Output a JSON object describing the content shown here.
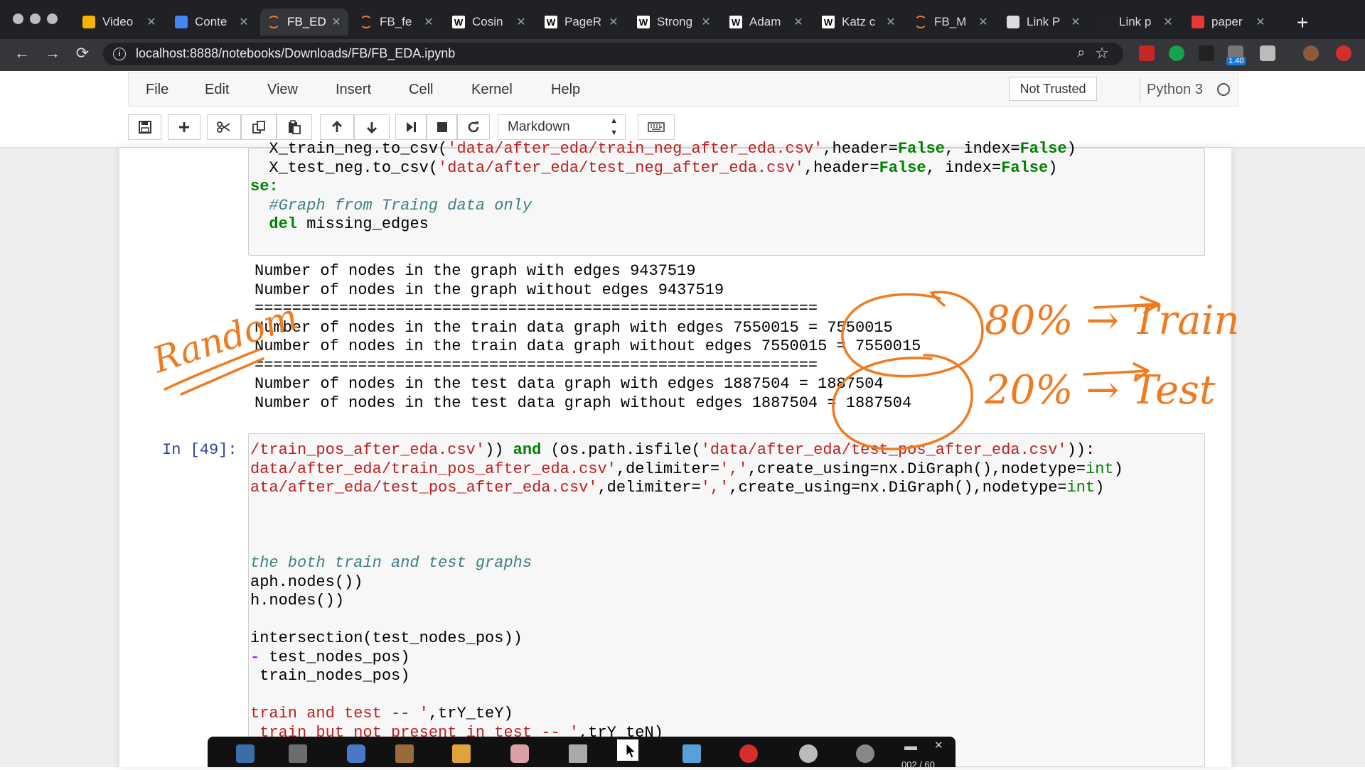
{
  "browser": {
    "tabs": [
      {
        "title": "Video",
        "icon": "google-drive-icon",
        "active": false
      },
      {
        "title": "Conte",
        "icon": "google-docs-icon",
        "active": false
      },
      {
        "title": "FB_ED",
        "icon": "jupyter-icon",
        "active": true
      },
      {
        "title": "FB_fe",
        "icon": "jupyter-icon",
        "active": false
      },
      {
        "title": "Cosin",
        "icon": "wikipedia-icon",
        "active": false
      },
      {
        "title": "PageR",
        "icon": "wikipedia-icon",
        "active": false
      },
      {
        "title": "Strong",
        "icon": "wikipedia-icon",
        "active": false
      },
      {
        "title": "Adam",
        "icon": "wikipedia-icon",
        "active": false
      },
      {
        "title": "Katz c",
        "icon": "wikipedia-icon",
        "active": false
      },
      {
        "title": "FB_M",
        "icon": "jupyter-icon",
        "active": false
      },
      {
        "title": "Link P",
        "icon": "document-icon",
        "active": false
      },
      {
        "title": "Link p",
        "icon": "github-icon",
        "active": false
      },
      {
        "title": "paper",
        "icon": "pdf-icon",
        "active": false
      }
    ],
    "new_tab_label": "+",
    "url": "localhost:8888/notebooks/Downloads/FB/FB_EDA.ipynb",
    "extension_badge": "1.40",
    "icons": {
      "back": "←",
      "forward": "→",
      "reload": "⟳",
      "zoom": "⌕",
      "star": "☆"
    }
  },
  "jupyter": {
    "menus": [
      "File",
      "Edit",
      "View",
      "Insert",
      "Cell",
      "Kernel",
      "Help"
    ],
    "trust_status": "Not Trusted",
    "kernel_name": "Python 3",
    "toolbar_icons": [
      "save-icon",
      "add-cell-icon",
      "cut-icon",
      "copy-icon",
      "paste-icon",
      "move-up-icon",
      "move-down-icon",
      "run-icon",
      "stop-icon",
      "restart-icon",
      "keyboard-icon"
    ],
    "cell_type": "Markdown"
  },
  "cells": {
    "cell1": {
      "code_lines": [
        [
          {
            "t": "  X_train_neg.to_csv("
          },
          {
            "t": "'data/after_eda/train_neg_after_eda.csv'",
            "c": "str"
          },
          {
            "t": ",header="
          },
          {
            "t": "False",
            "c": "kw"
          },
          {
            "t": ", index="
          },
          {
            "t": "False",
            "c": "kw"
          },
          {
            "t": ")"
          }
        ],
        [
          {
            "t": "  X_test_neg.to_csv("
          },
          {
            "t": "'data/after_eda/test_neg_after_eda.csv'",
            "c": "str"
          },
          {
            "t": ",header="
          },
          {
            "t": "False",
            "c": "kw"
          },
          {
            "t": ", index="
          },
          {
            "t": "False",
            "c": "kw"
          },
          {
            "t": ")"
          }
        ],
        [
          {
            "t": "se:",
            "c": "kw"
          }
        ],
        [
          {
            "t": "  "
          },
          {
            "t": "#Graph from Traing data only",
            "c": "cm"
          }
        ],
        [
          {
            "t": "  "
          },
          {
            "t": "del",
            "c": "kw"
          },
          {
            "t": " missing_edges"
          }
        ]
      ],
      "output_lines": [
        "Number of nodes in the graph with edges 9437519",
        "Number of nodes in the graph without edges 9437519",
        "============================================================",
        "Number of nodes in the train data graph with edges 7550015 = 7550015",
        "Number of nodes in the train data graph without edges 7550015 = 7550015",
        "============================================================",
        "Number of nodes in the test data graph with edges 1887504 = 1887504",
        "Number of nodes in the test data graph without edges 1887504 = 1887504"
      ]
    },
    "cell2": {
      "prompt": "In [49]:",
      "code_lines": [
        [
          {
            "t": "/train_pos_after_eda.csv'",
            "c": "str"
          },
          {
            "t": ")) "
          },
          {
            "t": "and",
            "c": "kw"
          },
          {
            "t": " (os.path.isfile("
          },
          {
            "t": "'data/after_eda/test_pos_after_eda.csv'",
            "c": "str"
          },
          {
            "t": ")):"
          }
        ],
        [
          {
            "t": "data/after_eda/train_pos_after_eda.csv'",
            "c": "str"
          },
          {
            "t": ",delimiter="
          },
          {
            "t": "','",
            "c": "str"
          },
          {
            "t": ",create_using=nx.DiGraph(),nodetype="
          },
          {
            "t": "int",
            "c": "bi"
          },
          {
            "t": ")"
          }
        ],
        [
          {
            "t": "ata/after_eda/test_pos_after_eda.csv'",
            "c": "str"
          },
          {
            "t": ",delimiter="
          },
          {
            "t": "','",
            "c": "str"
          },
          {
            "t": ",create_using=nx.DiGraph(),nodetype="
          },
          {
            "t": "int",
            "c": "bi"
          },
          {
            "t": ")"
          }
        ],
        [
          {
            "t": ""
          }
        ],
        [
          {
            "t": ""
          }
        ],
        [
          {
            "t": ""
          }
        ],
        [
          {
            "t": "the both train and test graphs",
            "c": "cm"
          }
        ],
        [
          {
            "t": "aph.nodes())"
          }
        ],
        [
          {
            "t": "h.nodes())"
          }
        ],
        [
          {
            "t": ""
          }
        ],
        [
          {
            "t": "intersection(test_nodes_pos))"
          }
        ],
        [
          {
            "t": "-",
            "c": "op"
          },
          {
            "t": " test_nodes_pos)"
          }
        ],
        [
          {
            "t": " train_nodes_pos)"
          }
        ],
        [
          {
            "t": ""
          }
        ],
        [
          {
            "t": "train and test -- '",
            "c": "str"
          },
          {
            "t": ",trY_teY)"
          }
        ],
        [
          {
            "t": " train but not present in test -- '",
            "c": "str"
          },
          {
            "t": ",trY_teN)"
          }
        ]
      ]
    }
  },
  "handwritten_annotations": {
    "left": "Random",
    "right_top": "80% → Train",
    "right_bottom": "20% → Test"
  },
  "screen_toolbar": {
    "page_counter": "002 / 60"
  },
  "colors": {
    "annotation": "#f07a1f",
    "accent_prompt": "#303f9f"
  }
}
